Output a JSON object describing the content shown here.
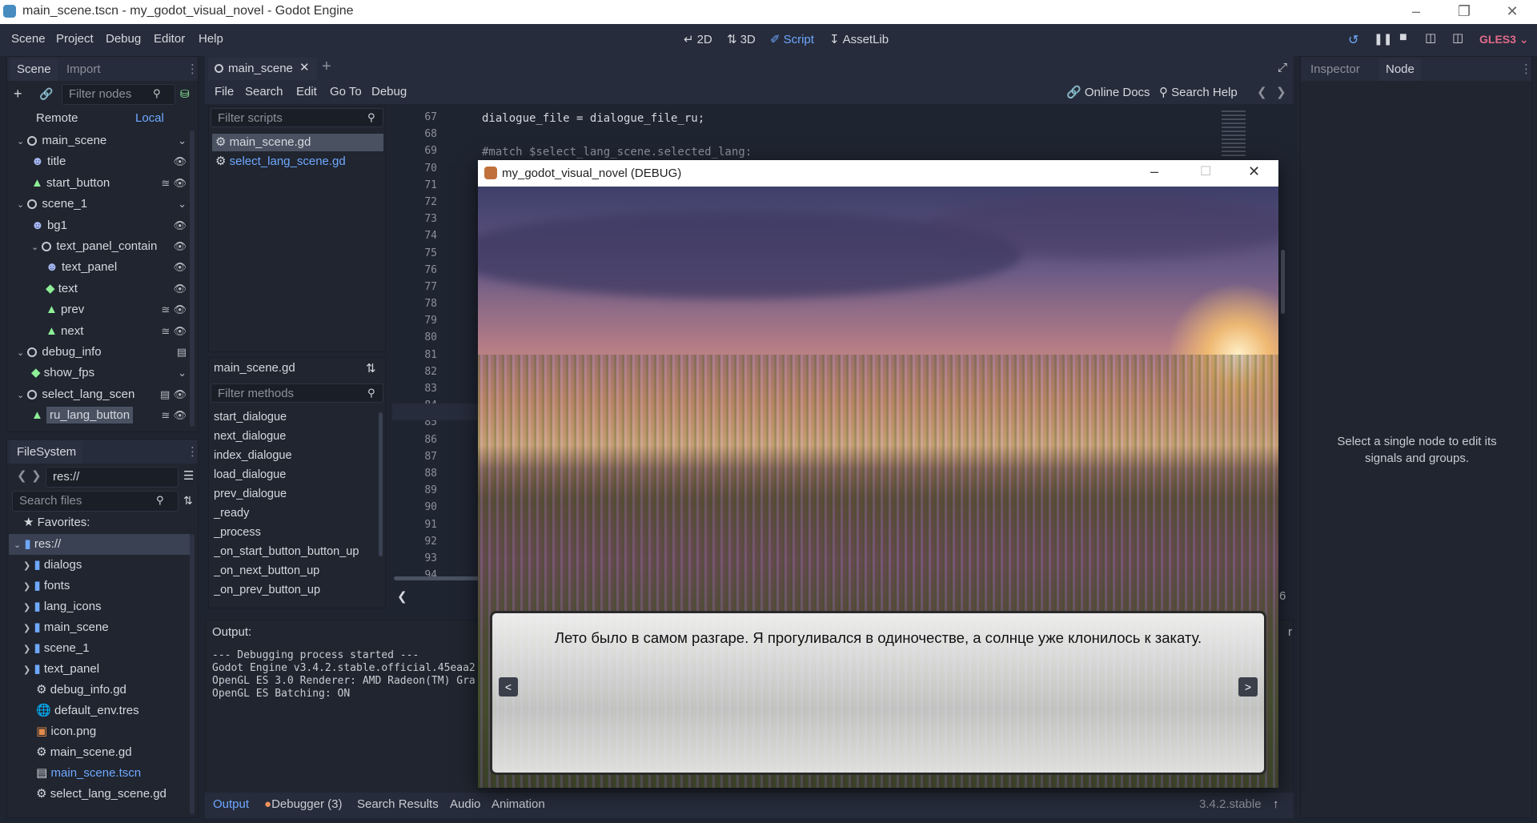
{
  "window": {
    "title": "main_scene.tscn - my_godot_visual_novel - Godot Engine"
  },
  "menu": [
    "Scene",
    "Project",
    "Debug",
    "Editor",
    "Help"
  ],
  "workspaces": {
    "d2": "2D",
    "d3": "3D",
    "script": "Script",
    "assetlib": "AssetLib"
  },
  "renderer": "GLES3",
  "scene_dock": {
    "tabs": [
      "Scene",
      "Import"
    ],
    "filter_placeholder": "Filter nodes",
    "remote": "Remote",
    "local": "Local",
    "nodes": [
      {
        "label": "main_scene",
        "indent": 0,
        "icon": "node-icon",
        "extra": "collapse"
      },
      {
        "label": "title",
        "indent": 1,
        "icon": "sprite-icon",
        "extra": "eye"
      },
      {
        "label": "start_button",
        "indent": 1,
        "icon": "button-icon",
        "extra": "signal-eye"
      },
      {
        "label": "scene_1",
        "indent": 0,
        "icon": "node-icon",
        "extra": "collapse"
      },
      {
        "label": "bg1",
        "indent": 1,
        "icon": "sprite-icon",
        "extra": "eye"
      },
      {
        "label": "text_panel_contain",
        "indent": 1,
        "icon": "node-icon",
        "extra": "eye"
      },
      {
        "label": "text_panel",
        "indent": 2,
        "icon": "sprite-icon",
        "extra": "eye"
      },
      {
        "label": "text",
        "indent": 2,
        "icon": "label-icon",
        "extra": "eye"
      },
      {
        "label": "prev",
        "indent": 2,
        "icon": "button-icon",
        "extra": "signal-eye"
      },
      {
        "label": "next",
        "indent": 2,
        "icon": "button-icon",
        "extra": "signal-eye"
      },
      {
        "label": "debug_info",
        "indent": 0,
        "icon": "node-icon",
        "extra": "script"
      },
      {
        "label": "show_fps",
        "indent": 1,
        "icon": "label-icon",
        "extra": "collapse"
      },
      {
        "label": "select_lang_scen",
        "indent": 0,
        "icon": "node-icon",
        "extra": "script-eye"
      },
      {
        "label": "ru_lang_button",
        "indent": 1,
        "icon": "button-icon",
        "extra": "signal-eye"
      }
    ]
  },
  "filesystem": {
    "title": "FileSystem",
    "path": "res://",
    "search_placeholder": "Search files",
    "favorites": "Favorites:",
    "items": [
      {
        "label": "res://",
        "type": "folder",
        "indent": 0
      },
      {
        "label": "dialogs",
        "type": "folder",
        "indent": 1
      },
      {
        "label": "fonts",
        "type": "folder",
        "indent": 1
      },
      {
        "label": "lang_icons",
        "type": "folder",
        "indent": 1
      },
      {
        "label": "main_scene",
        "type": "folder",
        "indent": 1
      },
      {
        "label": "scene_1",
        "type": "folder",
        "indent": 1
      },
      {
        "label": "text_panel",
        "type": "folder",
        "indent": 1
      },
      {
        "label": "debug_info.gd",
        "type": "gear",
        "indent": 1
      },
      {
        "label": "default_env.tres",
        "type": "globe",
        "indent": 1
      },
      {
        "label": "icon.png",
        "type": "image",
        "indent": 1
      },
      {
        "label": "main_scene.gd",
        "type": "gear",
        "indent": 1
      },
      {
        "label": "main_scene.tscn",
        "type": "scene",
        "indent": 1
      },
      {
        "label": "select_lang_scene.gd",
        "type": "gear",
        "indent": 1
      }
    ]
  },
  "script_editor": {
    "tab": "main_scene",
    "menu": [
      "File",
      "Search",
      "Edit",
      "Go To",
      "Debug"
    ],
    "online_docs": "Online Docs",
    "search_help": "Search Help",
    "filter_scripts": "Filter scripts",
    "scripts": [
      "main_scene.gd",
      "select_lang_scene.gd"
    ],
    "current_script": "main_scene.gd",
    "filter_methods": "Filter methods",
    "methods": [
      "start_dialogue",
      "next_dialogue",
      "index_dialogue",
      "load_dialogue",
      "prev_dialogue",
      "_ready",
      "_process",
      "_on_start_button_button_up",
      "_on_next_button_up",
      "_on_prev_button_up"
    ],
    "line_numbers": [
      "67",
      "68",
      "69",
      "70",
      "71",
      "72",
      "73",
      "74",
      "75",
      "76",
      "77",
      "78",
      "79",
      "80",
      "81",
      "82",
      "83",
      "84",
      "85",
      "86",
      "87",
      "88",
      "89",
      "90",
      "91",
      "92",
      "93",
      "94"
    ],
    "code_line_67": "dialogue_file = dialogue_file_ru;",
    "code_line_69": "#match $select_lang_scene.selected_lang:",
    "col_indicator": "6"
  },
  "output": {
    "title": "Output:",
    "lines": [
      "--- Debugging process started ---",
      "Godot Engine v3.4.2.stable.official.45eaa2",
      "OpenGL ES 3.0 Renderer: AMD Radeon(TM) Gra",
      "OpenGL ES Batching: ON"
    ],
    "right_fragment": "r"
  },
  "bottom_tabs": {
    "output": "Output",
    "debugger": "Debugger (3)",
    "search": "Search Results",
    "audio": "Audio",
    "animation": "Animation",
    "version": "3.4.2.stable"
  },
  "inspector": {
    "tabs": [
      "Inspector",
      "Node"
    ],
    "message": "Select a single node to edit its signals and groups."
  },
  "game_window": {
    "title": "my_godot_visual_novel (DEBUG)",
    "dialogue": "Лето было в самом разгаре. Я прогуливался в одиночестве, а солнце уже клонилось к закату.",
    "prev": "<",
    "next": ">"
  },
  "colors": {
    "accent": "#478cbf",
    "link": "#6fa8ff",
    "bg": "#1f2431",
    "panel": "#262c3b"
  }
}
